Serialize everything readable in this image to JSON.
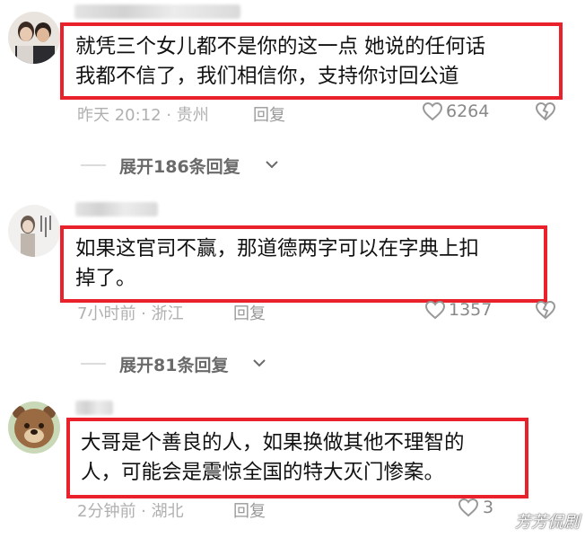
{
  "comments": [
    {
      "text_line1": "就凭三个女儿都不是你的这一点 她说的任何话",
      "text_line2": "我都不信了，我们相信你，支持你讨回公道",
      "meta": "昨天 20:12 · 贵州",
      "reply_label": "回复",
      "likes": "6264",
      "expand_label": "展开186条回复"
    },
    {
      "text_line1": "如果这官司不赢，那道德两字可以在字典上扣",
      "text_line2": "掉了。",
      "meta": "7小时前 · 浙江",
      "reply_label": "回复",
      "likes": "1357",
      "expand_label": "展开81条回复"
    },
    {
      "text_line1": "大哥是个善良的人，如果换做其他不理智的",
      "text_line2": "人，可能会是震惊全国的特大灭门惨案。",
      "meta": "2分钟前 · 湖北",
      "reply_label": "回复",
      "likes": "3"
    }
  ],
  "watermark": "芳芳侃剧",
  "colors": {
    "highlight_border": "#e8212b",
    "meta_text": "#b0b0b0",
    "icon": "#999999"
  }
}
